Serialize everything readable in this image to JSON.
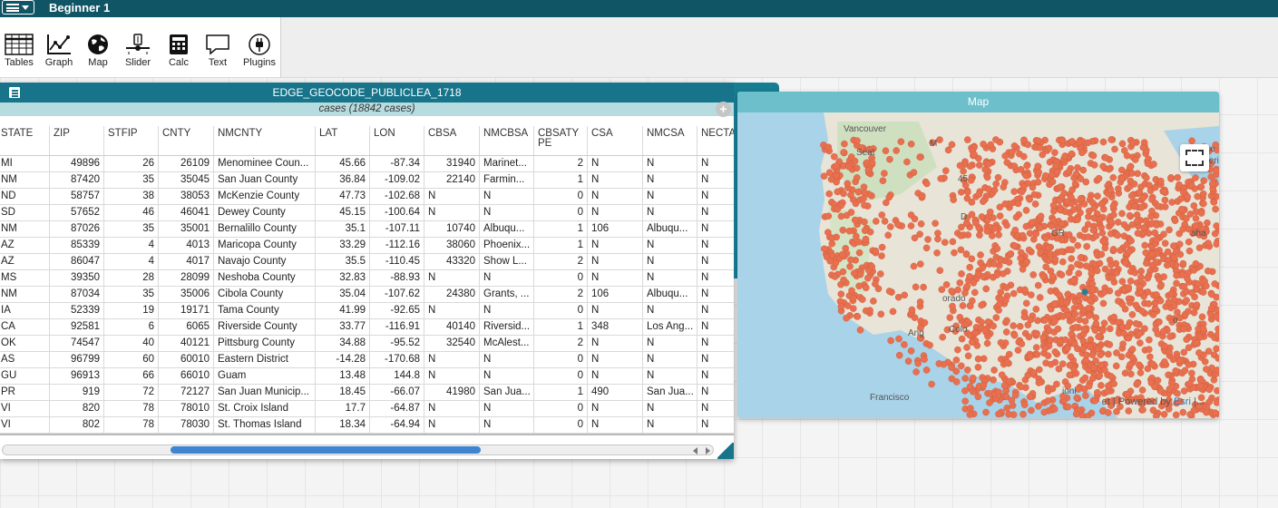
{
  "app": {
    "document_title": "Beginner 1"
  },
  "toolbar": {
    "tools": [
      {
        "label": "Tables"
      },
      {
        "label": "Graph"
      },
      {
        "label": "Map"
      },
      {
        "label": "Slider"
      },
      {
        "label": "Calc"
      },
      {
        "label": "Text"
      },
      {
        "label": "Plugins"
      }
    ]
  },
  "case_table": {
    "title": "EDGE_GEOCODE_PUBLICLEA_1718",
    "collection_label": "cases (18842 cases)",
    "add_button": "+",
    "columns": [
      "STATE",
      "ZIP",
      "STFIP",
      "CNTY",
      "NMCNTY",
      "LAT",
      "LON",
      "CBSA",
      "NMCBSA",
      "CBSATYPE",
      "CSA",
      "NMCSA",
      "NECTA"
    ],
    "rows": [
      [
        "MI",
        "49896",
        "26",
        "26109",
        "Menominee Coun...",
        "45.66",
        "-87.34",
        "31940",
        "Marinet...",
        "2",
        "N",
        "N",
        "N"
      ],
      [
        "NM",
        "87420",
        "35",
        "35045",
        "San Juan County",
        "36.84",
        "-109.02",
        "22140",
        "Farmin...",
        "1",
        "N",
        "N",
        "N"
      ],
      [
        "ND",
        "58757",
        "38",
        "38053",
        "McKenzie County",
        "47.73",
        "-102.68",
        "N",
        "N",
        "0",
        "N",
        "N",
        "N"
      ],
      [
        "SD",
        "57652",
        "46",
        "46041",
        "Dewey County",
        "45.15",
        "-100.64",
        "N",
        "N",
        "0",
        "N",
        "N",
        "N"
      ],
      [
        "NM",
        "87026",
        "35",
        "35001",
        "Bernalillo County",
        "35.1",
        "-107.11",
        "10740",
        "Albuqu...",
        "1",
        "106",
        "Albuqu...",
        "N"
      ],
      [
        "AZ",
        "85339",
        "4",
        "4013",
        "Maricopa County",
        "33.29",
        "-112.16",
        "38060",
        "Phoenix...",
        "1",
        "N",
        "N",
        "N"
      ],
      [
        "AZ",
        "86047",
        "4",
        "4017",
        "Navajo County",
        "35.5",
        "-110.45",
        "43320",
        "Show L...",
        "2",
        "N",
        "N",
        "N"
      ],
      [
        "MS",
        "39350",
        "28",
        "28099",
        "Neshoba County",
        "32.83",
        "-88.93",
        "N",
        "N",
        "0",
        "N",
        "N",
        "N"
      ],
      [
        "NM",
        "87034",
        "35",
        "35006",
        "Cibola County",
        "35.04",
        "-107.62",
        "24380",
        "Grants, ...",
        "2",
        "106",
        "Albuqu...",
        "N"
      ],
      [
        "IA",
        "52339",
        "19",
        "19171",
        "Tama County",
        "41.99",
        "-92.65",
        "N",
        "N",
        "0",
        "N",
        "N",
        "N"
      ],
      [
        "CA",
        "92581",
        "6",
        "6065",
        "Riverside County",
        "33.77",
        "-116.91",
        "40140",
        "Riversid...",
        "1",
        "348",
        "Los Ang...",
        "N"
      ],
      [
        "OK",
        "74547",
        "40",
        "40121",
        "Pittsburg County",
        "34.88",
        "-95.52",
        "32540",
        "McAlest...",
        "2",
        "N",
        "N",
        "N"
      ],
      [
        "AS",
        "96799",
        "60",
        "60010",
        "Eastern District",
        "-14.28",
        "-170.68",
        "N",
        "N",
        "0",
        "N",
        "N",
        "N"
      ],
      [
        "GU",
        "96913",
        "66",
        "66010",
        "Guam",
        "13.48",
        "144.8",
        "N",
        "N",
        "0",
        "N",
        "N",
        "N"
      ],
      [
        "PR",
        "919",
        "72",
        "72127",
        "San Juan Municip...",
        "18.45",
        "-66.07",
        "41980",
        "San Jua...",
        "1",
        "490",
        "San Jua...",
        "N"
      ],
      [
        "VI",
        "820",
        "78",
        "78010",
        "St. Croix Island",
        "17.7",
        "-64.87",
        "N",
        "N",
        "0",
        "N",
        "N",
        "N"
      ],
      [
        "VI",
        "802",
        "78",
        "78030",
        "St. Thomas Island",
        "18.34",
        "-64.94",
        "N",
        "N",
        "0",
        "N",
        "N",
        "N"
      ]
    ]
  },
  "map": {
    "title": "Map",
    "attribution_prefix": "et | Powered by ",
    "attribution_link": "Esri",
    "attribution_suffix": " |...",
    "labels": [
      "Vancouver",
      "Seat",
      "Francisco",
      "Ang",
      "Lake",
      "Superior",
      "GR",
      "aha",
      "D",
      "M",
      "45",
      "orado",
      "Colo",
      "ioni",
      "o"
    ],
    "point_color": "#e8704f",
    "selected_point_color": "#2a7f8f"
  },
  "colors": {
    "title_bar": "#0f5565",
    "table_header": "#17748a",
    "collection_bar": "#b7dcdf",
    "inspector": "#177d92",
    "map_header": "#6dbfcc"
  }
}
